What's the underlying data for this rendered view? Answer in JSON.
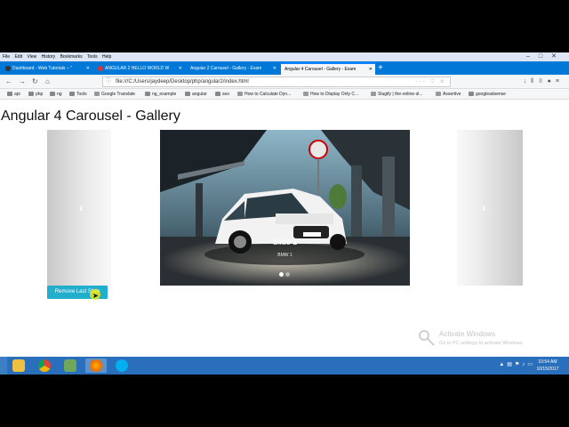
{
  "menubar": {
    "items": [
      "File",
      "Edit",
      "View",
      "History",
      "Bookmarks",
      "Tools",
      "Help"
    ]
  },
  "tabs": [
    {
      "title": "Dashboard - Web Tutorials -- \"",
      "favicon_color": "#333333"
    },
    {
      "title": "ANGULAR 2 HELLO WORLD W",
      "favicon_color": "#dd3333"
    },
    {
      "title": "Angular 2 Carousel - Gallery - Exam",
      "favicon_color": "#888888"
    },
    {
      "title": "Angular 4 Carousel - Gallery - Exam",
      "favicon_color": "#888888",
      "active": true
    }
  ],
  "navbar": {
    "url": "file:///C:/Users/jaydeep/Desktop/php/angular2/index.html"
  },
  "bookmarks": [
    "api",
    "php",
    "ng",
    "Tools",
    "Google Translate",
    "ng_example",
    "angular",
    "seo",
    "How to Calculate Dyn...",
    "How to Display Only C...",
    "Slugify | the-online-sl...",
    "Assertive",
    "googleadsense"
  ],
  "page": {
    "heading": "Angular 4 Carousel - Gallery",
    "slide_caption_title": "Slide 1",
    "slide_caption_sub": "BMW 1",
    "active_dot": 0,
    "dot_count": 2,
    "prev_arrow": "‹",
    "next_arrow": "›",
    "remove_button": "Remove Last Slide"
  },
  "watermark": {
    "title": "Activate Windows",
    "subtitle": "Go to PC settings to activate Windows"
  },
  "taskbar": {
    "apps": [
      "file-explorer",
      "chrome",
      "notepad",
      "firefox",
      "skype"
    ],
    "time": "10:54 AM",
    "date": "10/15/2017"
  },
  "colors": {
    "accent": "#22aecd",
    "tabstrip": "#0078d7",
    "taskbar": "#2a6fbb"
  }
}
